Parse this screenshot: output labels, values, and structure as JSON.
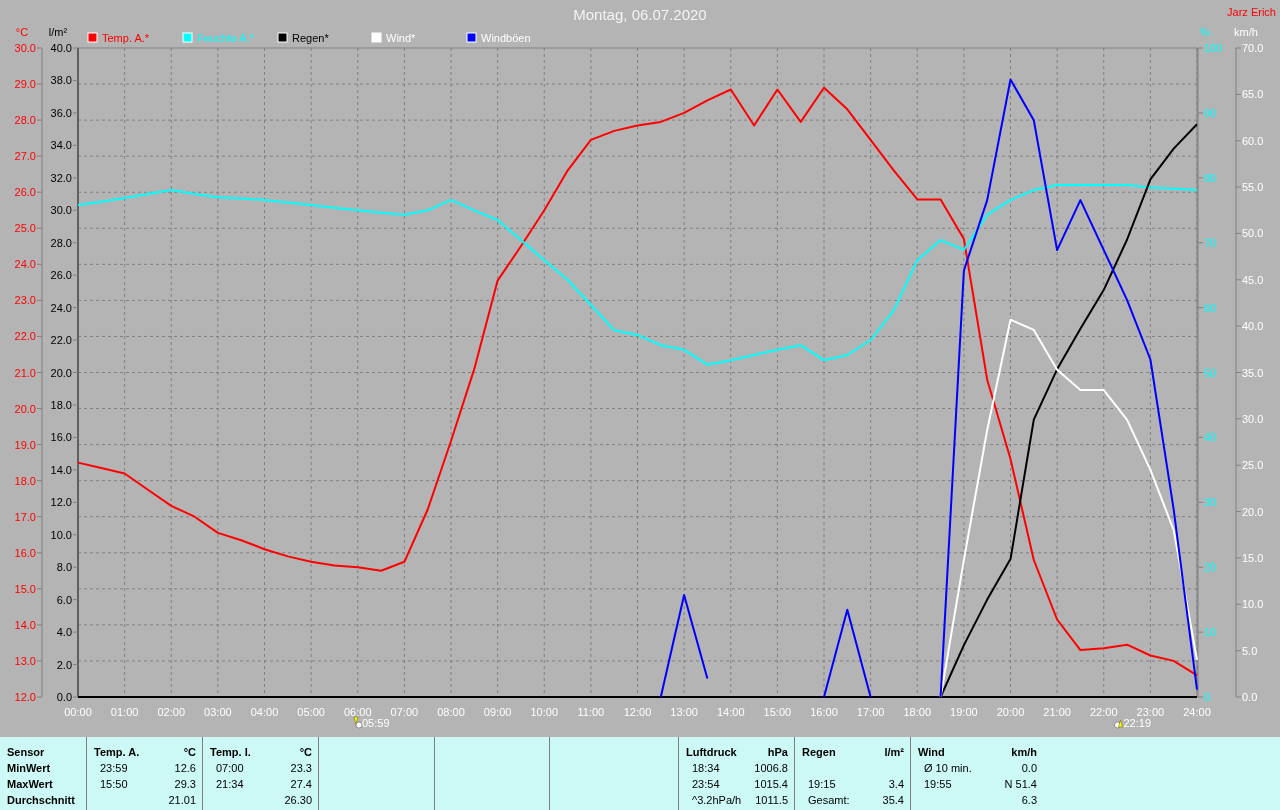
{
  "title": "Montag, 06.07.2020",
  "author": "Jarz Erich",
  "chart": {
    "chart_data": {
      "type": "line",
      "grid": true,
      "legend": "top",
      "xlim": [
        0,
        24
      ],
      "x": [
        0,
        0.5,
        1,
        1.5,
        2,
        2.5,
        3,
        3.5,
        4,
        4.5,
        5,
        5.5,
        6,
        6.5,
        7,
        7.5,
        8,
        8.5,
        9,
        9.5,
        10,
        10.5,
        11,
        11.5,
        12,
        12.5,
        13,
        13.5,
        14,
        14.5,
        15,
        15.5,
        16,
        16.5,
        17,
        17.5,
        18,
        18.5,
        19,
        19.5,
        20,
        20.5,
        21,
        21.5,
        22,
        22.5,
        23,
        23.5,
        24
      ],
      "xticks": [
        {
          "value": 0,
          "label": "00:00"
        },
        {
          "value": 1,
          "label": "01:00"
        },
        {
          "value": 2,
          "label": "02:00"
        },
        {
          "value": 3,
          "label": "03:00"
        },
        {
          "value": 4,
          "label": "04:00"
        },
        {
          "value": 5,
          "label": "05:00"
        },
        {
          "value": 6,
          "label": "06:00"
        },
        {
          "value": 7,
          "label": "07:00"
        },
        {
          "value": 8,
          "label": "08:00"
        },
        {
          "value": 9,
          "label": "09:00"
        },
        {
          "value": 10,
          "label": "10:00"
        },
        {
          "value": 11,
          "label": "11:00"
        },
        {
          "value": 12,
          "label": "12:00"
        },
        {
          "value": 13,
          "label": "13:00"
        },
        {
          "value": 14,
          "label": "14:00"
        },
        {
          "value": 15,
          "label": "15:00"
        },
        {
          "value": 16,
          "label": "16:00"
        },
        {
          "value": 17,
          "label": "17:00"
        },
        {
          "value": 18,
          "label": "18:00"
        },
        {
          "value": 19,
          "label": "19:00"
        },
        {
          "value": 20,
          "label": "20:00"
        },
        {
          "value": 21,
          "label": "21:00"
        },
        {
          "value": 22,
          "label": "22:00"
        },
        {
          "value": 23,
          "label": "23:00"
        },
        {
          "value": 24,
          "label": "24:00"
        }
      ],
      "ylabel": "°C",
      "ylim": [
        12,
        30
      ],
      "yticks": [
        {
          "value": 30,
          "label": "30.0"
        },
        {
          "value": 29,
          "label": "29.0"
        },
        {
          "value": 28,
          "label": "28.0"
        },
        {
          "value": 27,
          "label": "27.0"
        },
        {
          "value": 26,
          "label": "26.0"
        },
        {
          "value": 25,
          "label": "25.0"
        },
        {
          "value": 24,
          "label": "24.0"
        },
        {
          "value": 23,
          "label": "23.0"
        },
        {
          "value": 22,
          "label": "22.0"
        },
        {
          "value": 21,
          "label": "21.0"
        },
        {
          "value": 20,
          "label": "20.0"
        },
        {
          "value": 19,
          "label": "19.0"
        },
        {
          "value": 18,
          "label": "18.0"
        },
        {
          "value": 17,
          "label": "17.0"
        },
        {
          "value": 16,
          "label": "16.0"
        },
        {
          "value": 15,
          "label": "15.0"
        },
        {
          "value": 14,
          "label": "14.0"
        },
        {
          "value": 13,
          "label": "13.0"
        },
        {
          "value": 12,
          "label": "12.0"
        }
      ],
      "y2label": "l/m²",
      "y2lim": [
        0,
        40
      ],
      "y2ticks": [
        {
          "value": 40,
          "label": "40.0"
        },
        {
          "value": 38,
          "label": "38.0"
        },
        {
          "value": 36,
          "label": "36.0"
        },
        {
          "value": 34,
          "label": "34.0"
        },
        {
          "value": 32,
          "label": "32.0"
        },
        {
          "value": 30,
          "label": "30.0"
        },
        {
          "value": 28,
          "label": "28.0"
        },
        {
          "value": 26,
          "label": "26.0"
        },
        {
          "value": 24,
          "label": "24.0"
        },
        {
          "value": 22,
          "label": "22.0"
        },
        {
          "value": 20,
          "label": "20.0"
        },
        {
          "value": 18,
          "label": "18.0"
        },
        {
          "value": 16,
          "label": "16.0"
        },
        {
          "value": 14,
          "label": "14.0"
        },
        {
          "value": 12,
          "label": "12.0"
        },
        {
          "value": 10,
          "label": "10.0"
        },
        {
          "value": 8,
          "label": "8.0"
        },
        {
          "value": 6,
          "label": "6.0"
        },
        {
          "value": 4,
          "label": "4.0"
        },
        {
          "value": 2,
          "label": "2.0"
        },
        {
          "value": 0,
          "label": "0.0"
        }
      ],
      "y3label": "%",
      "y3lim": [
        0,
        100
      ],
      "y3ticks": [
        100,
        90,
        80,
        70,
        60,
        50,
        40,
        30,
        20,
        10,
        0
      ],
      "series": [
        {
          "name": "Temp. A.*",
          "color": "#ff0000",
          "values": [
            18.5,
            18.35,
            18.2,
            17.75,
            17.3,
            17.0,
            16.55,
            16.35,
            16.1,
            15.9,
            15.75,
            15.65,
            15.6,
            15.5,
            15.75,
            17.2,
            19.1,
            21.1,
            23.55,
            24.5,
            25.5,
            26.6,
            27.45,
            27.7,
            27.85,
            27.95,
            28.2,
            28.55,
            28.85,
            27.85,
            28.85,
            27.95,
            28.9,
            28.3,
            27.45,
            26.6,
            25.8,
            25.8,
            24.7,
            20.8,
            18.6,
            15.8,
            14.15,
            13.3,
            13.35,
            13.45,
            13.15,
            13.0,
            12.6
          ]
        },
        {
          "name": "Feuchte A.*",
          "color": "#00ffff",
          "axis": "y3",
          "values": [
            75.8,
            76.3,
            76.9,
            77.5,
            78.1,
            77.5,
            77,
            76.8,
            76.6,
            76.2,
            75.8,
            75.4,
            75,
            74.6,
            74.3,
            75,
            76.6,
            75,
            73.5,
            70.4,
            67.3,
            64.3,
            60.4,
            56.5,
            55.8,
            54.2,
            53.5,
            51.2,
            51.9,
            52.7,
            53.5,
            54.2,
            51.9,
            52.7,
            55,
            59.6,
            67.3,
            70.4,
            68.9,
            74.3,
            76.6,
            78.1,
            78.9,
            78.9,
            78.9,
            78.9,
            78.5,
            78.3,
            78.1
          ]
        },
        {
          "name": "Regen*",
          "color": "#000000",
          "axis": "y2",
          "values": [
            null,
            null,
            null,
            null,
            null,
            null,
            null,
            null,
            null,
            null,
            null,
            null,
            null,
            null,
            null,
            null,
            null,
            null,
            null,
            null,
            null,
            null,
            null,
            null,
            null,
            null,
            null,
            null,
            null,
            null,
            null,
            null,
            null,
            null,
            null,
            null,
            null,
            0,
            3.2,
            6,
            8.5,
            17.1,
            20.2,
            22.7,
            25.1,
            28.2,
            31.9,
            33.8,
            35.3
          ]
        }
      ]
    }
  },
  "wind_chart": {
    "chart_data": {
      "type": "line",
      "legend": "top",
      "xlim": [
        0,
        24
      ],
      "x": [
        12.5,
        13,
        13.5,
        16,
        16.5,
        17,
        18.5,
        19,
        19.5,
        20,
        20.5,
        21,
        21.5,
        22,
        22.5,
        23,
        23.5,
        24
      ],
      "ylabel": "km/h",
      "ylim": [
        0,
        70
      ],
      "yticks": [
        {
          "value": 70,
          "label": "70.0"
        },
        {
          "value": 65,
          "label": "65.0"
        },
        {
          "value": 60,
          "label": "60.0"
        },
        {
          "value": 55,
          "label": "55.0"
        },
        {
          "value": 50,
          "label": "50.0"
        },
        {
          "value": 45,
          "label": "45.0"
        },
        {
          "value": 40,
          "label": "40.0"
        },
        {
          "value": 35,
          "label": "35.0"
        },
        {
          "value": 30,
          "label": "30.0"
        },
        {
          "value": 25,
          "label": "25.0"
        },
        {
          "value": 20,
          "label": "20.0"
        },
        {
          "value": 15,
          "label": "15.0"
        },
        {
          "value": 10,
          "label": "10.0"
        },
        {
          "value": 5,
          "label": "5.0"
        },
        {
          "value": 0,
          "label": "0.0"
        }
      ],
      "series": [
        {
          "name": "Wind*",
          "color": "#ffffff",
          "values": [
            null,
            null,
            null,
            null,
            null,
            null,
            0,
            14.8,
            28.8,
            40.7,
            39.6,
            35.3,
            33.1,
            33.1,
            29.9,
            24.5,
            18,
            4
          ]
        },
        {
          "name": "Windböen",
          "color": "#0000ff",
          "values": [
            0,
            11,
            2,
            0,
            9.4,
            0,
            0,
            46,
            53.6,
            66.6,
            62.2,
            48.2,
            53.6,
            48.2,
            42.8,
            36.4,
            20.2,
            0.8
          ]
        }
      ]
    }
  },
  "sun": [
    {
      "kind": "sunrise",
      "time": "05:59"
    },
    {
      "kind": "sunset",
      "time": "22:19"
    }
  ],
  "summary": [
    {
      "kind": "labels",
      "rows": [
        "Sensor",
        "MinWert",
        "MaxWert",
        "Durchschnitt"
      ]
    },
    {
      "kind": "values",
      "name": "Temp. A.",
      "unit": "°C",
      "rows": [
        {
          "time": "23:59",
          "value": "12.6"
        },
        {
          "time": "15:50",
          "value": "29.3"
        },
        {
          "value": "21.01"
        }
      ]
    },
    {
      "kind": "values",
      "name": "Temp. I.",
      "unit": "°C",
      "rows": [
        {
          "time": "07:00",
          "value": "23.3"
        },
        {
          "time": "21:34",
          "value": "27.4"
        },
        {
          "value": "26.30"
        }
      ]
    },
    {
      "kind": "empty"
    },
    {
      "kind": "empty"
    },
    {
      "kind": "empty"
    },
    {
      "kind": "values",
      "name": "Luftdruck",
      "unit": "hPa",
      "rows": [
        {
          "time": "18:34",
          "value": "1006.8"
        },
        {
          "time": "23:54",
          "value": "1015.4"
        },
        {
          "time": "^3.2hPa/h",
          "value": "1011.5"
        }
      ]
    },
    {
      "kind": "values",
      "name": "Regen",
      "unit": "l/m²",
      "rows": [
        null,
        {
          "time": "19:15",
          "value": "3.4"
        },
        {
          "time": "Gesamt:",
          "value": "35.4"
        }
      ]
    },
    {
      "kind": "values",
      "name": "Wind",
      "unit": "km/h",
      "rows": [
        {
          "time": "Ø 10 min.",
          "value": "0.0"
        },
        {
          "time": "19:55",
          "value": "N 51.4"
        },
        {
          "value": "6.3"
        }
      ]
    }
  ]
}
